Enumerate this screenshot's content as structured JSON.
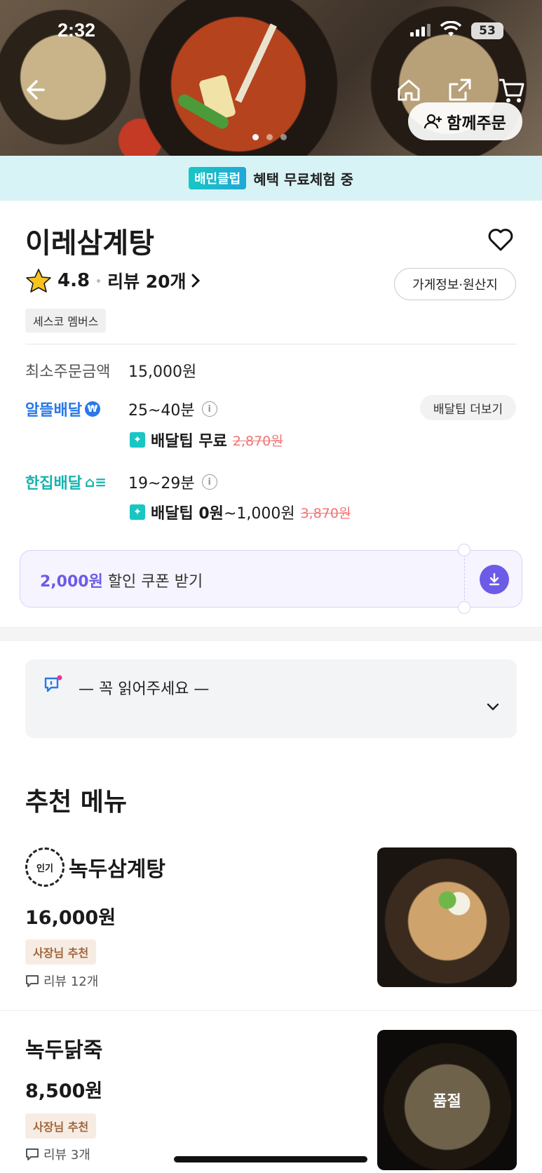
{
  "status_bar": {
    "time": "2:32",
    "battery": "53"
  },
  "hero": {
    "group_order_label": "함께주문",
    "slide_count": 3,
    "active_slide": 1
  },
  "club_banner": {
    "badge": "배민클럽",
    "text": "혜택 무료체험 중"
  },
  "store": {
    "name": "이레삼계탕",
    "rating": "4.8",
    "review_label": "리뷰 20개",
    "info_button": "가게정보·원산지",
    "member_badge": "세스코 멤버스"
  },
  "order_info": {
    "min_order_label": "최소주문금액",
    "min_order_value": "15,000원",
    "altteul": {
      "label": "알뜰배달",
      "time": "25~40분",
      "tip_label": "배달팁 무료",
      "tip_original": "2,870원",
      "more_button": "배달팁 더보기"
    },
    "hanjip": {
      "label": "한집배달",
      "time": "19~29분",
      "tip_label": "배달팁 0원",
      "tip_range": "~1,000원",
      "tip_original": "3,870원"
    }
  },
  "coupon": {
    "amount": "2,000원",
    "text": " 할인 쿠폰 받기"
  },
  "notice": {
    "title": "— 꼭 읽어주세요 —"
  },
  "recommended": {
    "title": "추천 메뉴",
    "items": [
      {
        "badge": "인기",
        "name": "녹두삼계탕",
        "price": "16,000원",
        "tag": "사장님 추천",
        "reviews": "리뷰 12개"
      },
      {
        "name": "녹두닭죽",
        "price": "8,500원",
        "tag": "사장님 추천",
        "reviews": "리뷰 3개",
        "status": "품절"
      }
    ]
  },
  "colors": {
    "baemin_mint": "#18c6c4",
    "altteul_blue": "#2a78e8",
    "coupon_purple": "#6c5be7",
    "strike_red": "#f07575"
  },
  "icons": [
    "back-arrow-icon",
    "home-icon",
    "share-icon",
    "cart-icon",
    "add-person-icon",
    "heart-icon",
    "star-icon",
    "chevron-right-icon",
    "info-icon",
    "download-icon",
    "notice-icon",
    "chevron-down-icon",
    "review-bubble-icon"
  ]
}
